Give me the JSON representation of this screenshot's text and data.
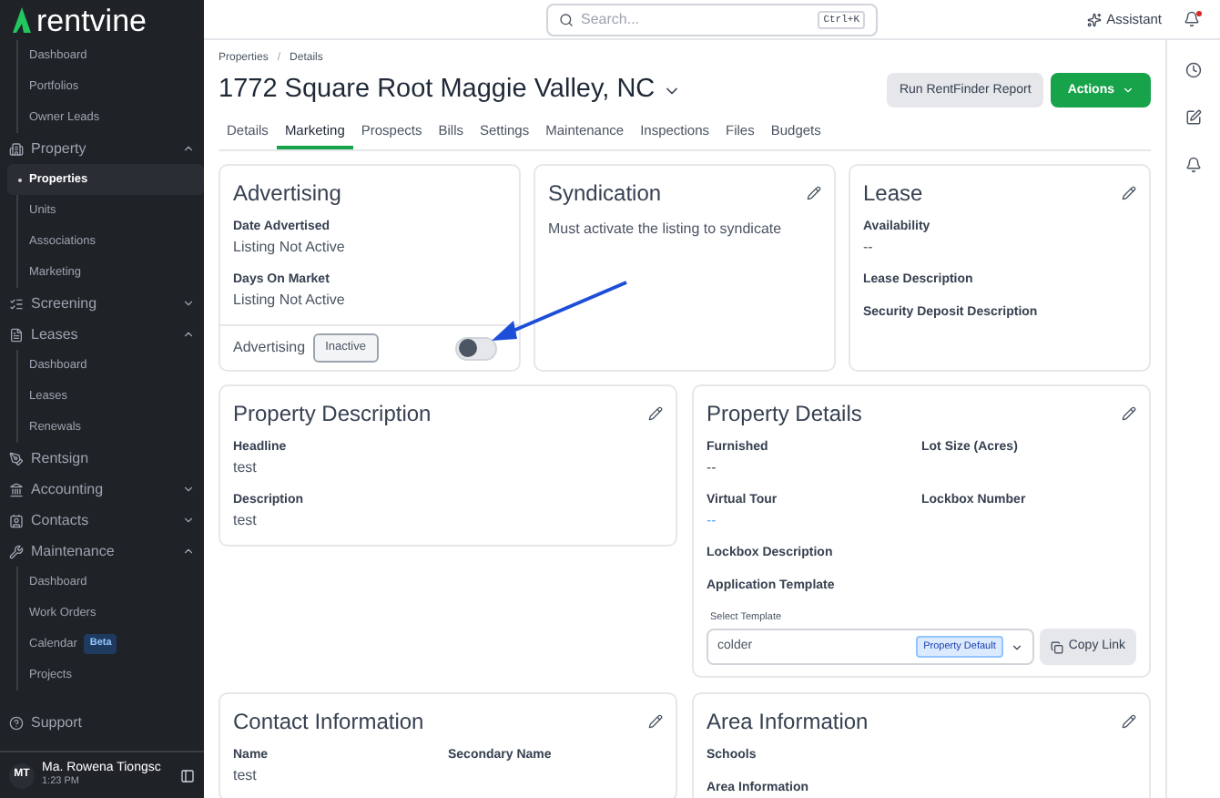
{
  "sidebar": {
    "logo": "rentvine",
    "items": [
      {
        "kind": "sublist",
        "children": [
          {
            "label": "Dashboard",
            "selected": false
          },
          {
            "label": "Portfolios",
            "selected": false
          },
          {
            "label": "Owner Leads",
            "selected": false
          }
        ]
      },
      {
        "kind": "group",
        "label": "Property",
        "expanded": true,
        "children": [
          {
            "label": "Properties",
            "selected": true
          },
          {
            "label": "Units",
            "selected": false
          },
          {
            "label": "Associations",
            "selected": false
          },
          {
            "label": "Marketing",
            "selected": false
          }
        ]
      },
      {
        "kind": "group",
        "label": "Screening",
        "expanded": false
      },
      {
        "kind": "group",
        "label": "Leases",
        "expanded": true,
        "children": [
          {
            "label": "Dashboard",
            "selected": false
          },
          {
            "label": "Leases",
            "selected": false
          },
          {
            "label": "Renewals",
            "selected": false
          }
        ]
      },
      {
        "kind": "link",
        "label": "Rentsign"
      },
      {
        "kind": "group",
        "label": "Accounting",
        "expanded": false
      },
      {
        "kind": "group",
        "label": "Contacts",
        "expanded": false
      },
      {
        "kind": "group",
        "label": "Maintenance",
        "expanded": true,
        "children": [
          {
            "label": "Dashboard",
            "selected": false
          },
          {
            "label": "Work Orders",
            "selected": false
          },
          {
            "label": "Calendar",
            "selected": false,
            "badge": "Beta"
          },
          {
            "label": "Projects",
            "selected": false
          }
        ]
      }
    ],
    "support": "Support",
    "user": {
      "initials": "MT",
      "name": "Ma. Rowena Tiongsc",
      "time": "1:23 PM"
    }
  },
  "topbar": {
    "search": {
      "placeholder": "Search...",
      "shortcut": "Ctrl+K"
    },
    "assistant": "Assistant",
    "notification_dot": true
  },
  "breadcrumbs": [
    "Properties",
    "Details"
  ],
  "breadcrumb_separator": "/",
  "title": "1772 Square Root Maggie Valley, NC",
  "buttons": {
    "secondary": "Run RentFinder Report",
    "primary": "Actions"
  },
  "tabs": [
    {
      "label": "Details",
      "selected": false
    },
    {
      "label": "Marketing",
      "selected": true
    },
    {
      "label": "Prospects",
      "selected": false
    },
    {
      "label": "Bills",
      "selected": false
    },
    {
      "label": "Settings",
      "selected": false
    },
    {
      "label": "Maintenance",
      "selected": false
    },
    {
      "label": "Inspections",
      "selected": false
    },
    {
      "label": "Files",
      "selected": false
    },
    {
      "label": "Budgets",
      "selected": false
    }
  ],
  "advertising": {
    "title": "Advertising",
    "fields": [
      {
        "label": "Date Advertised",
        "value": "Listing Not Active"
      },
      {
        "label": "Days On Market",
        "value": "Listing Not Active"
      }
    ],
    "footer_label": "Advertising",
    "status": "Inactive",
    "on": false
  },
  "syndication": {
    "title": "Syndication",
    "text": "Must activate the listing to syndicate"
  },
  "lease": {
    "title": "Lease",
    "fields": [
      {
        "label": "Availability",
        "value": "--"
      },
      {
        "label": "Lease Description"
      },
      {
        "label": "Security Deposit Description"
      }
    ]
  },
  "property_description": {
    "title": "Property Description",
    "fields": [
      {
        "label": "Headline",
        "value": "test"
      },
      {
        "label": "Description",
        "value": "test"
      }
    ]
  },
  "property_details": {
    "title": "Property Details",
    "grid": [
      {
        "label": "Furnished",
        "value": "--",
        "kind": "text"
      },
      {
        "label": "Lot Size (Acres)",
        "kind": "text"
      },
      {
        "label": "Virtual Tour",
        "value": "--",
        "kind": "link"
      },
      {
        "label": "Lockbox Number",
        "kind": "text"
      }
    ],
    "fields": [
      {
        "label": "Lockbox Description"
      },
      {
        "label": "Application Template"
      }
    ],
    "template": {
      "label": "Select Template",
      "value": "colder",
      "tag": "Property Default",
      "copy": "Copy Link"
    }
  },
  "contact_information": {
    "title": "Contact Information",
    "columns": [
      [
        {
          "label": "Name",
          "value": "test"
        }
      ],
      [
        {
          "label": "Secondary Name"
        }
      ]
    ]
  },
  "area_information": {
    "title": "Area Information",
    "fields": [
      {
        "label": "Schools"
      },
      {
        "label": "Area Information"
      }
    ]
  }
}
